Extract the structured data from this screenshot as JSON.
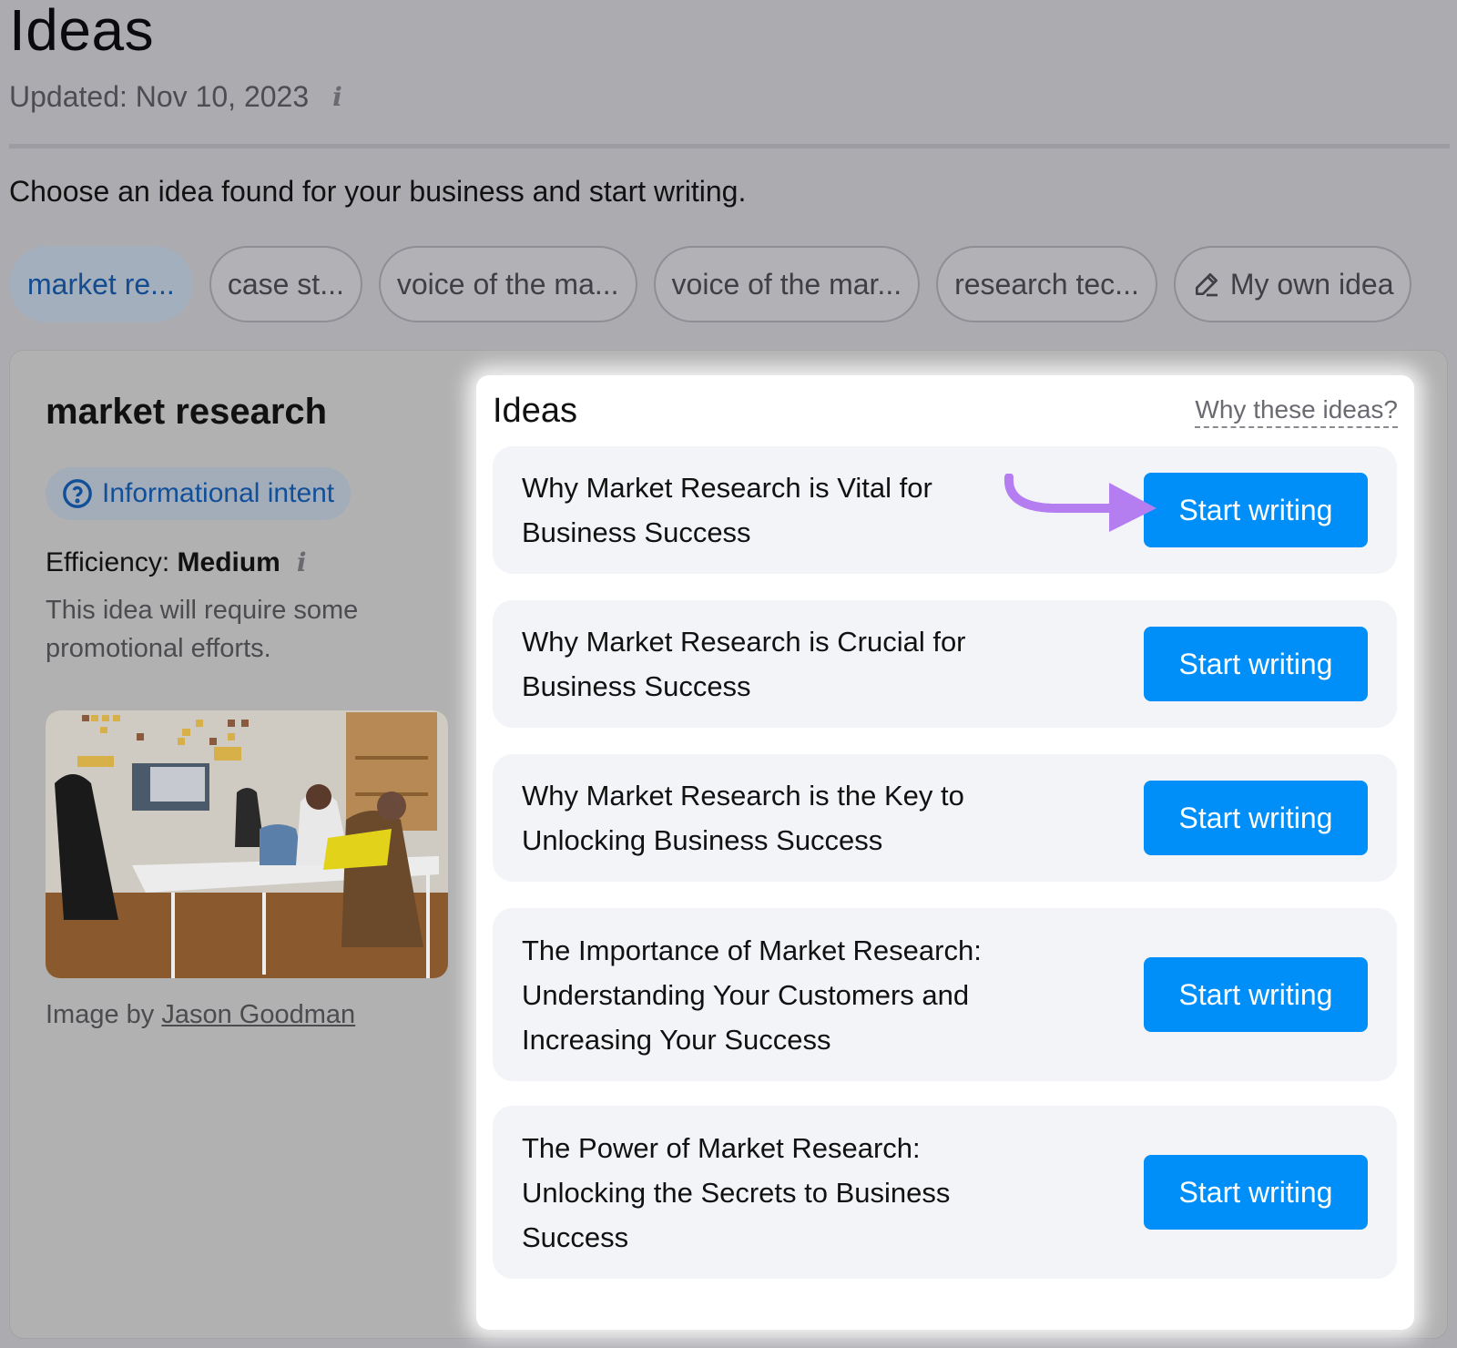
{
  "header": {
    "title": "Ideas",
    "updated": "Updated: Nov 10, 2023",
    "info_icon": "info-icon",
    "intro": "Choose an idea found for your business and start writing."
  },
  "chips": [
    {
      "label": "market re...",
      "active": true
    },
    {
      "label": "case st...",
      "active": false
    },
    {
      "label": "voice of the ma...",
      "active": false
    },
    {
      "label": "voice of the mar...",
      "active": false
    },
    {
      "label": "research tec...",
      "active": false
    },
    {
      "label": "My own idea",
      "icon": "pencil-icon",
      "active": false
    }
  ],
  "topic": {
    "title": "market research",
    "intent": "Informational intent",
    "intent_icon": "question-circle-icon",
    "efficiency_label": "Efficiency:",
    "efficiency_value": "Medium",
    "efficiency_desc": "This idea will require some promotional efforts.",
    "image_credit_prefix": "Image by",
    "image_credit_author": "Jason Goodman"
  },
  "ideas": {
    "title": "Ideas",
    "why_link": "Why these ideas?",
    "items": [
      {
        "text": "Why Market Research is Vital for Business Success",
        "button": "Start writing"
      },
      {
        "text": "Why Market Research is Crucial for Business Success",
        "button": "Start writing"
      },
      {
        "text": "Why Market Research is the Key to Unlocking Business Success",
        "button": "Start writing"
      },
      {
        "text": "The Importance of Market Research: Understanding Your Customers and Increasing Your Success",
        "button": "Start writing"
      },
      {
        "text": "The Power of Market Research: Unlocking the Secrets to Business Success",
        "button": "Start writing"
      }
    ]
  },
  "colors": {
    "accent": "#008ff8",
    "annotation_arrow": "#b57ef0",
    "intent_text": "#114f99"
  }
}
